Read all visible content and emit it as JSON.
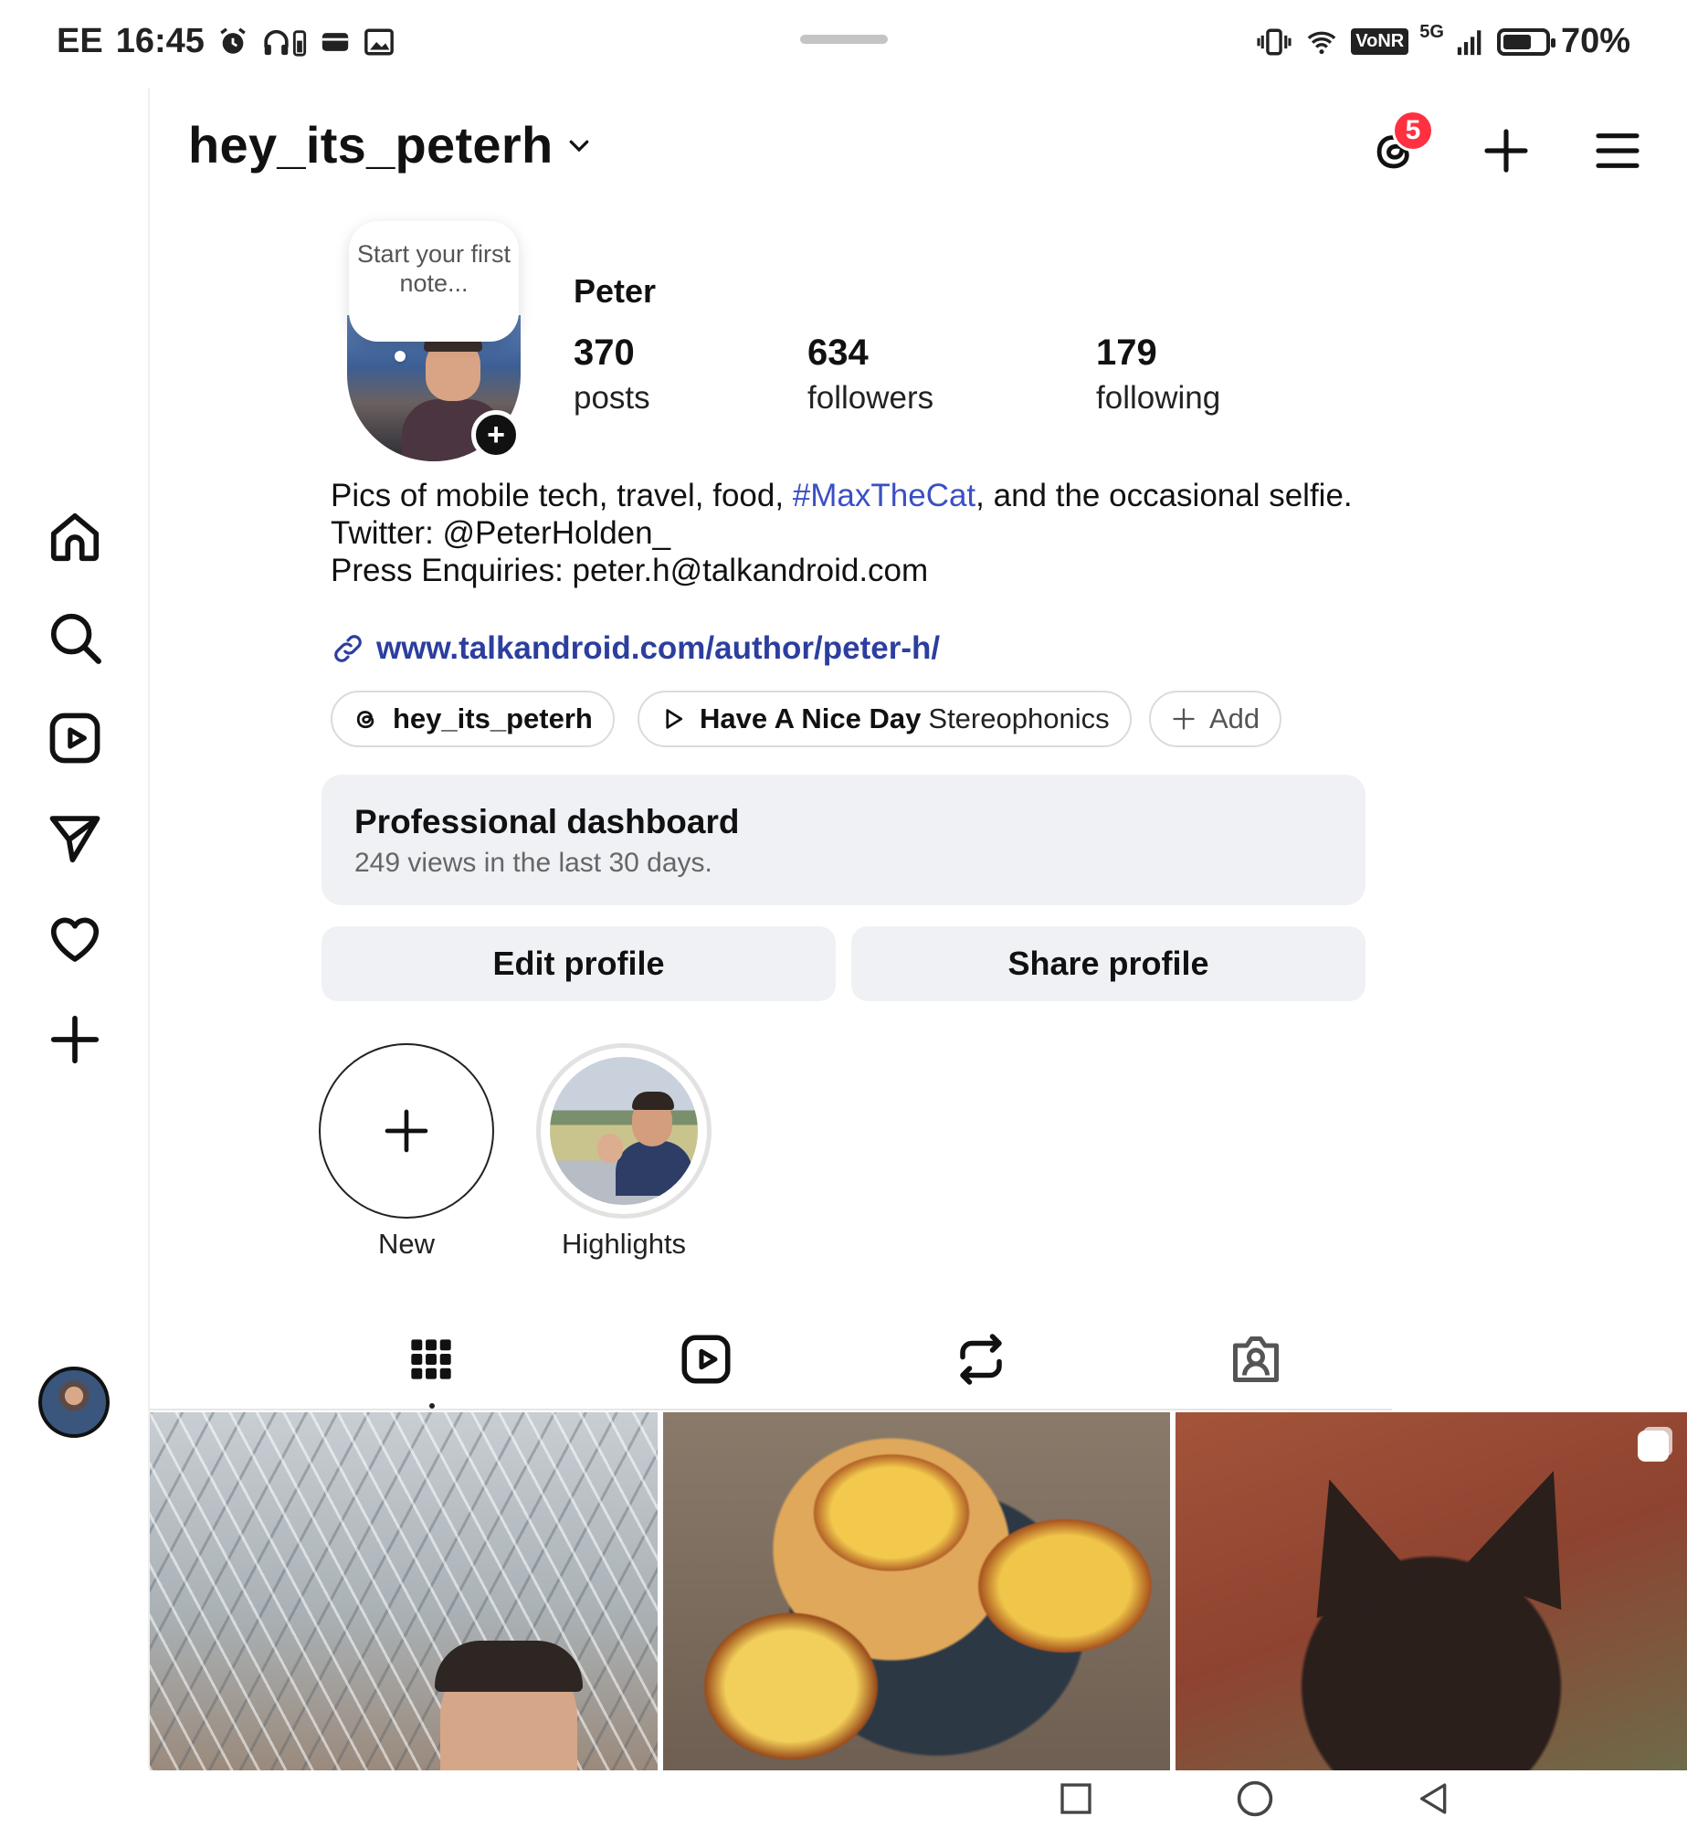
{
  "status_bar": {
    "carrier": "EE",
    "time": "16:45",
    "battery_text": "70%",
    "network_label": "5G",
    "volte_label": "VoNR",
    "left_icons": [
      "alarm-icon",
      "headphones-battery-icon",
      "card-icon",
      "image-icon"
    ],
    "right_icons": [
      "vibrate-icon",
      "wifi-icon",
      "volte-icon",
      "signal-icon",
      "battery-icon"
    ]
  },
  "header": {
    "username": "hey_its_peterh",
    "dropdown_glyph": "⌄",
    "threads_badge": "5"
  },
  "note": {
    "text": "Start your first note..."
  },
  "profile": {
    "display_name": "Peter",
    "stats": [
      {
        "num": "370",
        "label": "posts"
      },
      {
        "num": "634",
        "label": "followers"
      },
      {
        "num": "179",
        "label": "following"
      }
    ],
    "bio": {
      "line1_pre": "Pics of mobile tech, travel, food, ",
      "hashtag": "#MaxTheCat",
      "line1_post": ", and the occasional selfie.",
      "twitter": "Twitter: @PeterHolden_",
      "press": "Press Enquiries: peter.h@talkandroid.com",
      "link": "www.talkandroid.com/author/peter-h/"
    },
    "chips": {
      "threads_handle": "hey_its_peterh",
      "song_title": "Have A Nice Day",
      "song_artist": "Stereophonics",
      "add_label": "Add"
    }
  },
  "dashboard": {
    "title": "Professional dashboard",
    "subtitle": "249 views in the last 30 days."
  },
  "buttons": {
    "edit": "Edit profile",
    "share": "Share profile"
  },
  "highlights": {
    "new_label": "New",
    "highlight_label": "Highlights"
  },
  "tabs": [
    "grid-icon",
    "reels-icon",
    "reposts-icon",
    "tagged-icon"
  ],
  "left_rail": [
    "home-icon",
    "search-icon",
    "reels-icon",
    "direct-icon",
    "activity-heart-icon",
    "create-icon",
    "profile-avatar"
  ],
  "colors": {
    "accent_link": "#3b4fc4",
    "badge": "#ff3040",
    "card_bg": "#eff1f4"
  }
}
